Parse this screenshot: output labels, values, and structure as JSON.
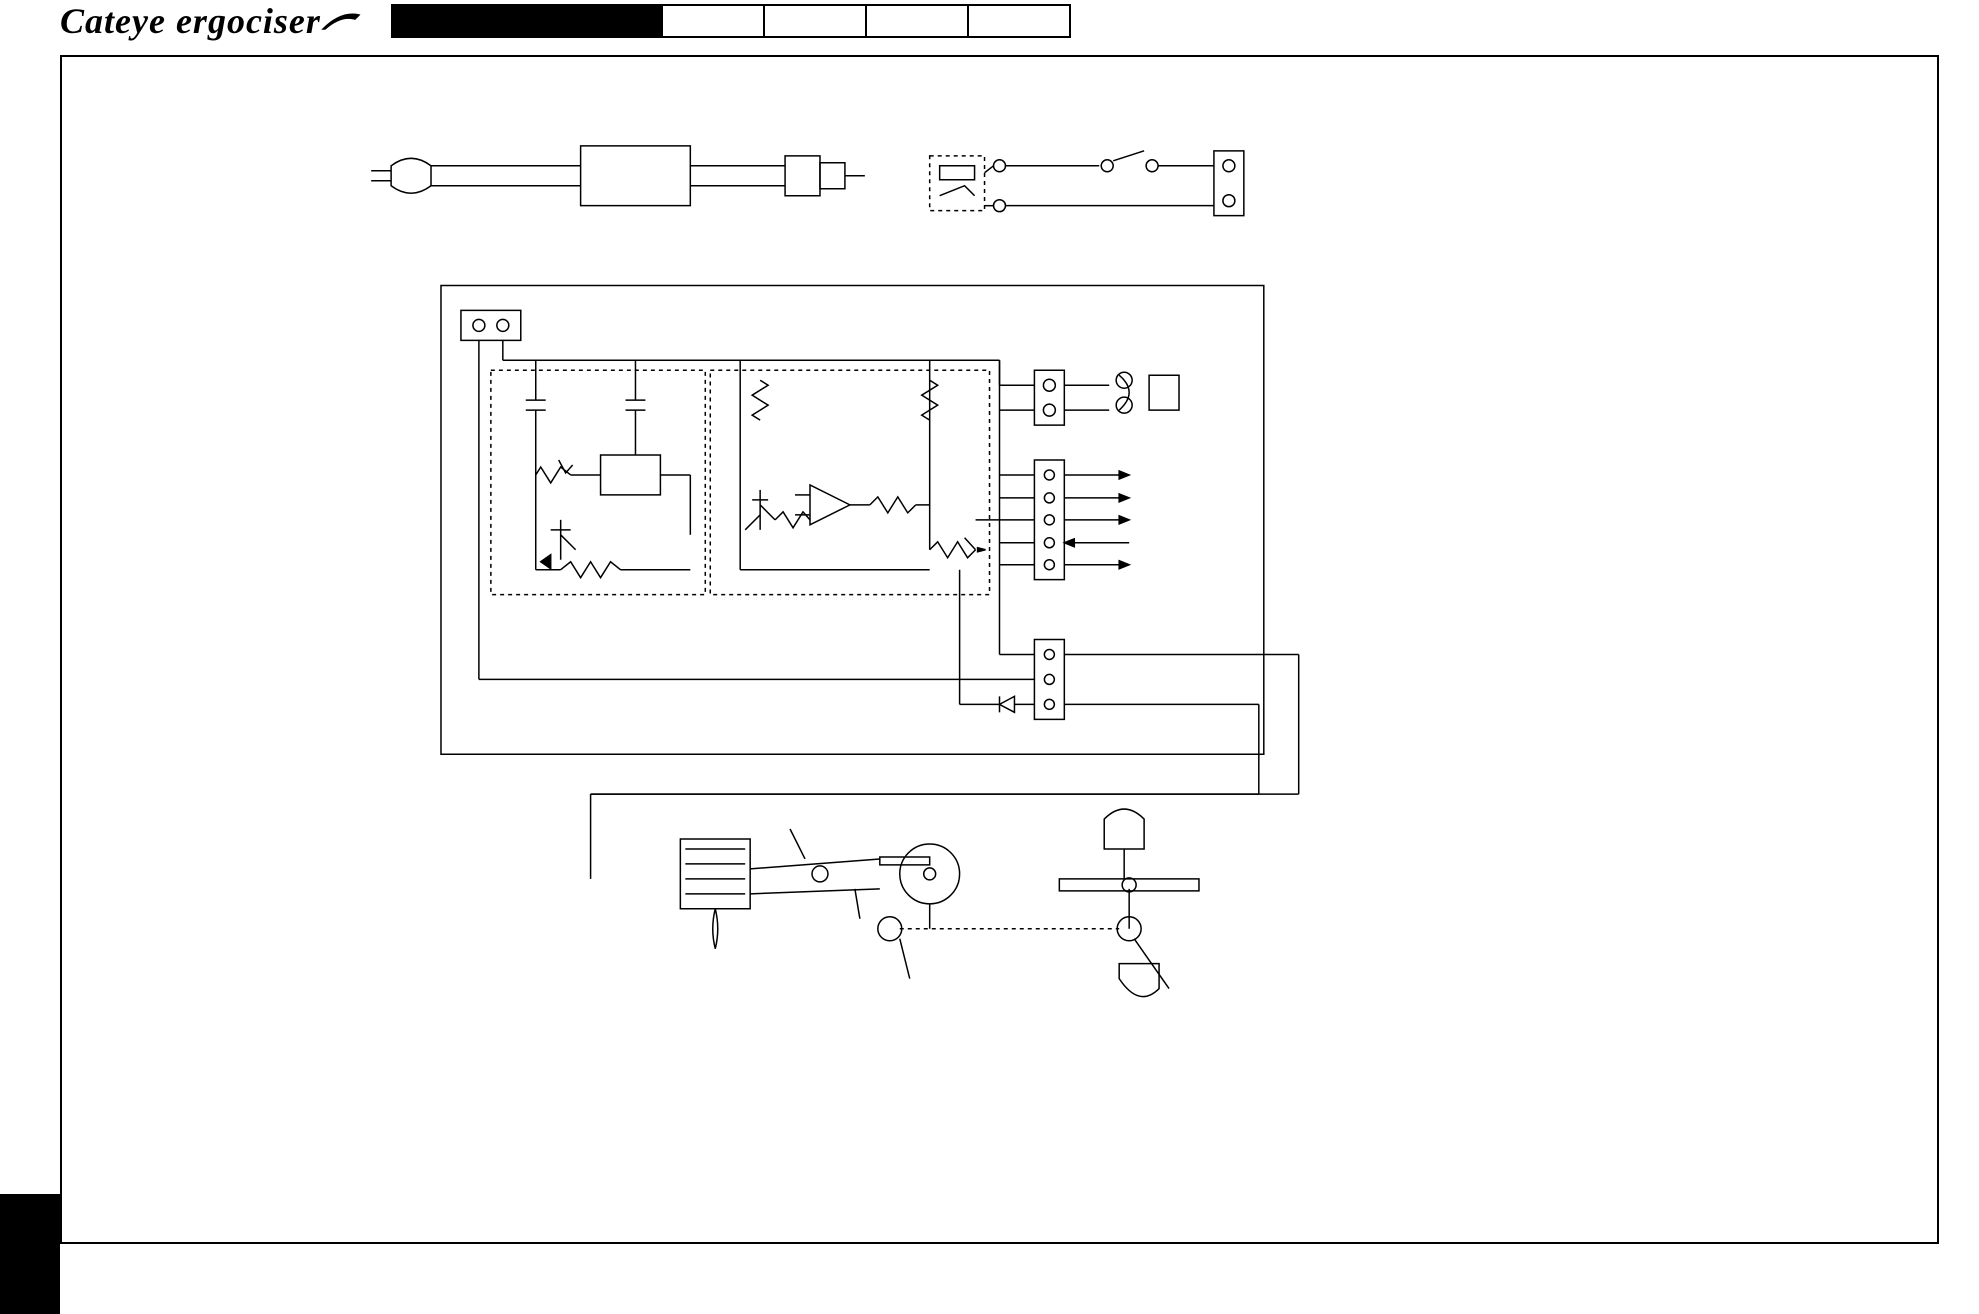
{
  "header": {
    "brand": "Cateye ergociser"
  },
  "diagram": {
    "components": {
      "ac_plug": "AC plug",
      "adapter": "AC adapter",
      "dc_jack": "DC jack",
      "fuse": "fuse",
      "power_switch": "power switch",
      "connector_2p_in": "2-pin connector (input)",
      "connector_2p_switch": "2-pin connector (switch)",
      "regulator_block": "voltage regulator section",
      "regulator_ic": "regulator IC",
      "capacitor_1": "capacitor",
      "capacitor_2": "capacitor",
      "resistor": "resistor",
      "potentiometer": "potentiometer",
      "transistor": "transistor",
      "control_block": "control/amplifier section",
      "opamp": "op-amp",
      "connector_2p_a": "2-pin connector A",
      "connector_5p": "5-pin connector",
      "connector_3p": "3-pin connector",
      "zener": "zener diode",
      "sensor_module": "sensor",
      "solenoid": "solenoid / electromagnet",
      "brake_lever": "brake lever",
      "belt_pulley": "pulley",
      "flywheel": "flywheel",
      "pedal_crank": "pedal crank",
      "magnet": "magnet",
      "pickup": "pickup"
    }
  }
}
